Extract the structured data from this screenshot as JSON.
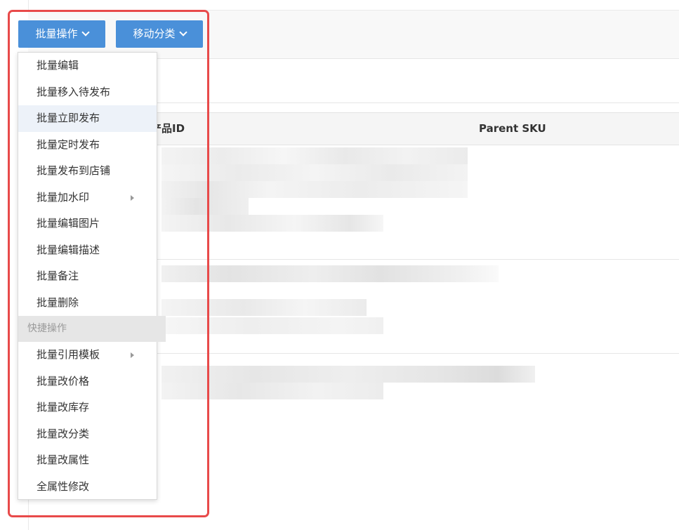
{
  "toolbar": {
    "batch_button": "批量操作",
    "move_button": "移动分类"
  },
  "table": {
    "headers": [
      "产品ID",
      "Parent SKU"
    ]
  },
  "batch_menu": {
    "items": [
      {
        "label": "批量编辑",
        "submenu": false
      },
      {
        "label": "批量移入待发布",
        "submenu": false
      },
      {
        "label": "批量立即发布",
        "submenu": false,
        "hovered": true
      },
      {
        "label": "批量定时发布",
        "submenu": false
      },
      {
        "label": "批量发布到店铺",
        "submenu": false
      },
      {
        "label": "批量加水印",
        "submenu": true
      },
      {
        "label": "批量编辑图片",
        "submenu": false
      },
      {
        "label": "批量编辑描述",
        "submenu": false
      },
      {
        "label": "批量备注",
        "submenu": false
      },
      {
        "label": "批量删除",
        "submenu": false
      }
    ],
    "group_label": "快捷操作",
    "quick_items": [
      {
        "label": "批量引用模板",
        "submenu": true
      },
      {
        "label": "批量改价格",
        "submenu": false
      },
      {
        "label": "批量改库存",
        "submenu": false
      },
      {
        "label": "批量改分类",
        "submenu": false
      },
      {
        "label": "批量改属性",
        "submenu": false
      },
      {
        "label": "全属性修改",
        "submenu": false
      }
    ]
  },
  "colors": {
    "button_bg": "#4a90d9",
    "highlight_frame": "#e84a4a",
    "hover_bg": "#edf2f9"
  }
}
